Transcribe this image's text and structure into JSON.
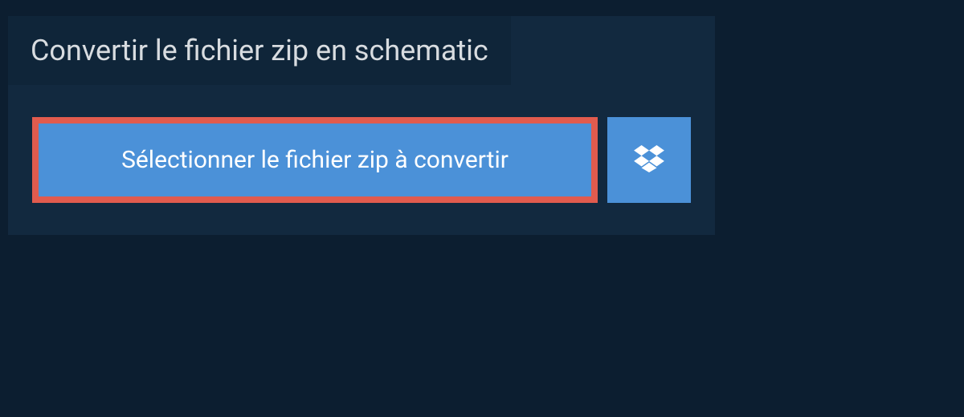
{
  "header": {
    "title": "Convertir le fichier zip en schematic"
  },
  "actions": {
    "select_file_label": "Sélectionner le fichier zip à convertir"
  },
  "colors": {
    "background": "#0c1e30",
    "panel": "#12293f",
    "title_bar": "#0f2539",
    "button": "#4b91d8",
    "highlight_border": "#e15b4e"
  }
}
